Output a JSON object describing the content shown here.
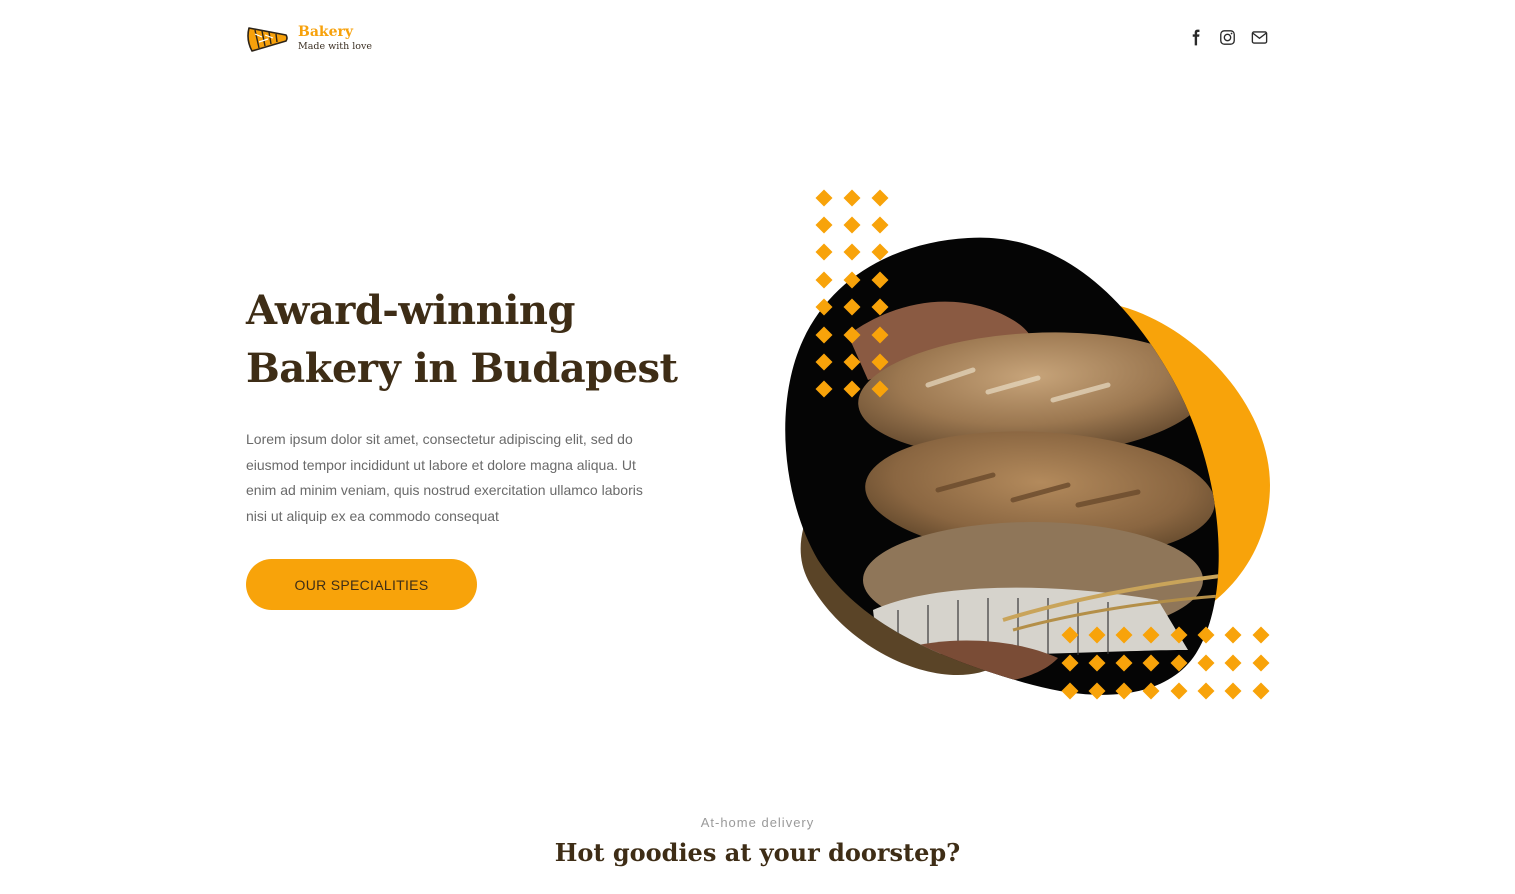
{
  "brand": {
    "name": "Bakery",
    "tagline": "Made with love",
    "logo_icon": "croissant-icon",
    "accent_color": "#f8a30a",
    "dark_color": "#3e2d16"
  },
  "social": [
    {
      "name": "facebook",
      "icon": "facebook-icon"
    },
    {
      "name": "instagram",
      "icon": "instagram-icon"
    },
    {
      "name": "email",
      "icon": "mail-icon"
    }
  ],
  "hero": {
    "title_line1": "Award-winning",
    "title_line2": "Bakery in Budapest",
    "text": "Lorem ipsum dolor sit amet, consectetur adipiscing elit, sed do eiusmod tempor incididunt ut labore et dolore magna aliqua. Ut enim ad minim veniam, quis nostrud exercitation ullamco laboris nisi ut aliquip ex ea commodo consequat",
    "cta_label": "OUR SPECIALITIES",
    "image": "stacked-bread-loaves-photo"
  },
  "delivery": {
    "eyebrow": "At-home delivery",
    "title": "Hot goodies at your doorstep?"
  }
}
